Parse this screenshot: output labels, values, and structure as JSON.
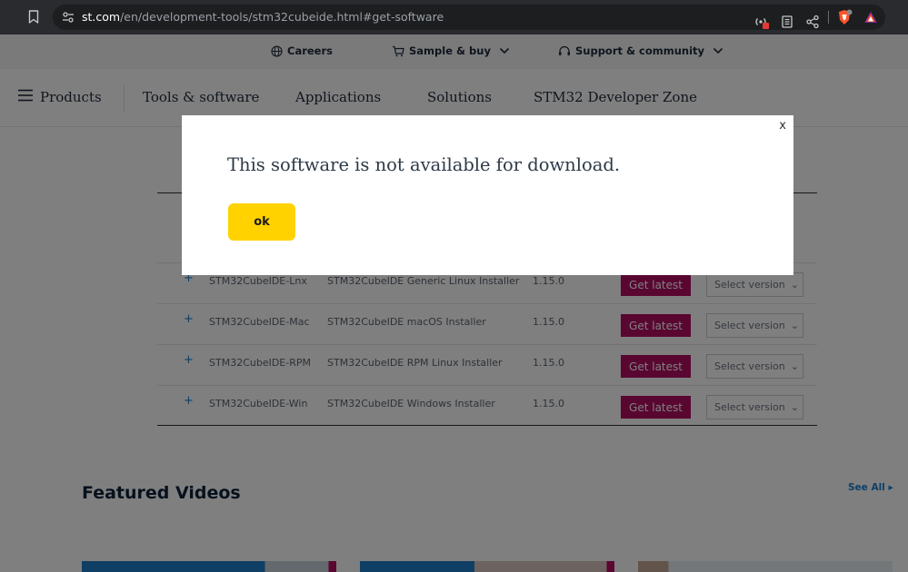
{
  "browser": {
    "url_host": "st.com",
    "url_path": "/en/development-tools/stm32cubeide.html#get-software"
  },
  "topnav": {
    "careers": "Careers",
    "sample_buy": "Sample & buy",
    "support": "Support & community"
  },
  "mainnav": {
    "products": "Products",
    "tools": "Tools & software",
    "applications": "Applications",
    "solutions": "Solutions",
    "dev_zone": "STM32 Developer Zone"
  },
  "software_table": {
    "rows": [
      {
        "part": "STM32CubeIDE-Lnx",
        "description": "STM32CubeIDE Generic Linux Installer",
        "version": "1.15.0",
        "action": "Get latest",
        "select": "Select version"
      },
      {
        "part": "STM32CubeIDE-Mac",
        "description": "STM32CubeIDE macOS Installer",
        "version": "1.15.0",
        "action": "Get latest",
        "select": "Select version"
      },
      {
        "part": "STM32CubeIDE-RPM",
        "description": "STM32CubeIDE RPM Linux Installer",
        "version": "1.15.0",
        "action": "Get latest",
        "select": "Select version"
      },
      {
        "part": "STM32CubeIDE-Win",
        "description": "STM32CubeIDE Windows Installer",
        "version": "1.15.0",
        "action": "Get latest",
        "select": "Select version"
      }
    ]
  },
  "featured": {
    "title": "Featured Videos",
    "see_all": "See All"
  },
  "modal": {
    "close_label": "x",
    "message": "This software is not available for download.",
    "ok_label": "ok"
  },
  "colors": {
    "accent_magenta": "#b30e63",
    "ok_yellow": "#ffd200",
    "link_blue": "#1a7fd0"
  }
}
